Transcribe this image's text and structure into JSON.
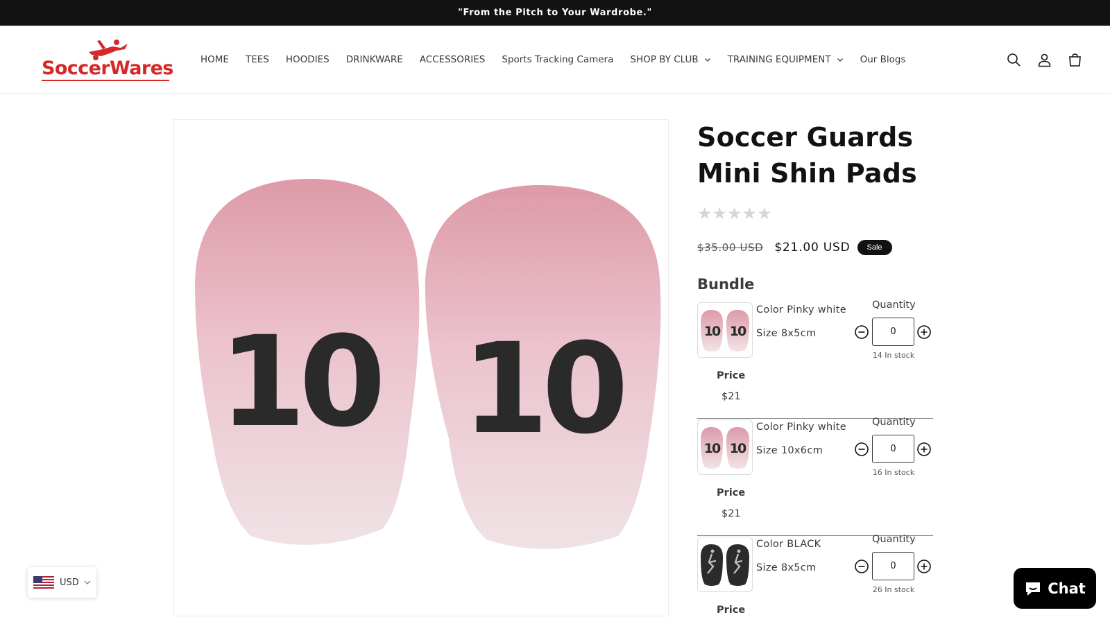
{
  "announcement": "\"From the Pitch to Your Wardrobe.\"",
  "brand": {
    "logo_text": "SoccerWares",
    "color": "#d62828"
  },
  "nav": {
    "items": [
      {
        "label": "HOME"
      },
      {
        "label": "TEES"
      },
      {
        "label": "HOODIES"
      },
      {
        "label": "DRINKWARE"
      },
      {
        "label": "ACCESSORIES"
      },
      {
        "label": "Sports Tracking Camera"
      },
      {
        "label": "SHOP BY CLUB",
        "dropdown": true
      },
      {
        "label": "TRAINING EQUIPMENT",
        "dropdown": true
      },
      {
        "label": "Our Blogs"
      }
    ]
  },
  "header_icons": [
    "search-icon",
    "account-icon",
    "cart-icon"
  ],
  "product": {
    "title": "Soccer Guards Mini Shin Pads",
    "rating": {
      "value": 0,
      "max": 5
    },
    "price_original": "$35.00 USD",
    "price_sale": "$21.00 USD",
    "sale_badge": "Sale",
    "image_number": "10"
  },
  "bundle": {
    "title": "Bundle",
    "quantity_label": "Quantity",
    "price_label": "Price",
    "items": [
      {
        "color": "Color Pinky white",
        "size": "Size 8x5cm",
        "quantity": "0",
        "stock": "14 In stock",
        "price": "$21",
        "thumb_style": "pink",
        "thumb_text": "10"
      },
      {
        "color": "Color Pinky white",
        "size": "Size 10x6cm",
        "quantity": "0",
        "stock": "16 In stock",
        "price": "$21",
        "thumb_style": "pink",
        "thumb_text": "10"
      },
      {
        "color": "Color BLACK",
        "size": "Size 8x5cm",
        "quantity": "0",
        "stock": "26 In stock",
        "price": "",
        "thumb_style": "black"
      }
    ]
  },
  "currency": {
    "code": "USD"
  },
  "chat": {
    "label": "Chat"
  },
  "colors": {
    "announcement_bg": "#121212",
    "sale_badge_bg": "#121212",
    "chat_bg": "#000000"
  }
}
